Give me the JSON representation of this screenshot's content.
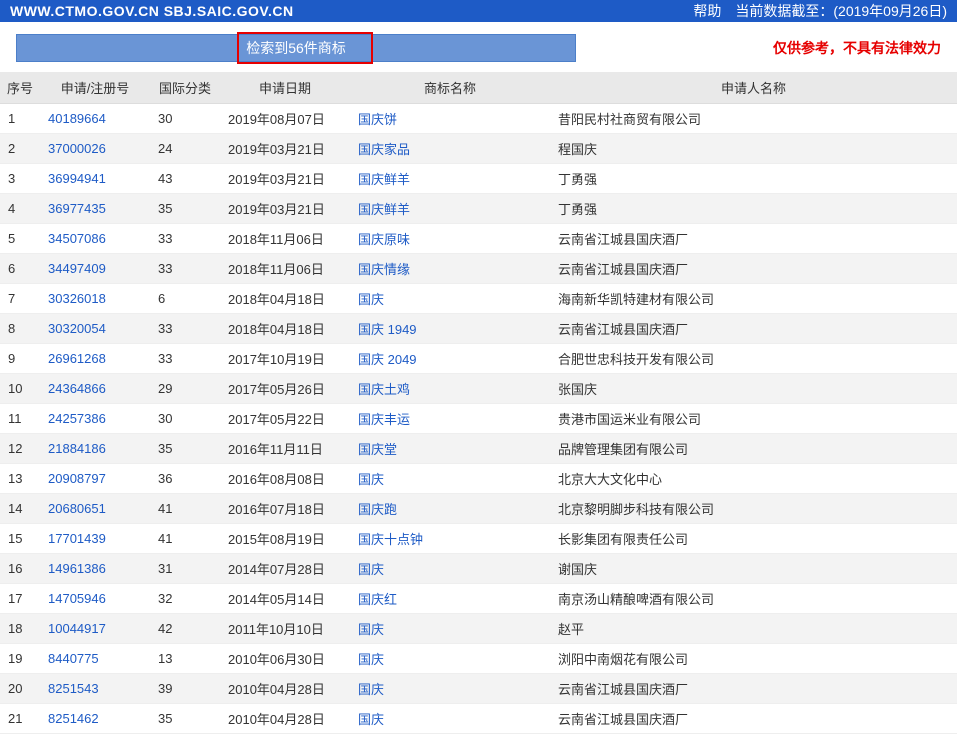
{
  "header": {
    "urls": "WWW.CTMO.GOV.CN SBJ.SAIC.GOV.CN",
    "help": "帮助",
    "data_date_label": "当前数据截至：(2019年09月26日)"
  },
  "result_banner": "检索到56件商标",
  "disclaimer": "仅供参考，不具有法律效力",
  "columns": {
    "seq": "序号",
    "reg": "申请/注册号",
    "cls": "国际分类",
    "date": "申请日期",
    "name": "商标名称",
    "applicant": "申请人名称"
  },
  "rows": [
    {
      "seq": "1",
      "reg": "40189664",
      "cls": "30",
      "date": "2019年08月07日",
      "name": "国庆饼",
      "applicant": "昔阳民村社商贸有限公司"
    },
    {
      "seq": "2",
      "reg": "37000026",
      "cls": "24",
      "date": "2019年03月21日",
      "name": "国庆家品",
      "applicant": "程国庆"
    },
    {
      "seq": "3",
      "reg": "36994941",
      "cls": "43",
      "date": "2019年03月21日",
      "name": "国庆鲜羊",
      "applicant": "丁勇强"
    },
    {
      "seq": "4",
      "reg": "36977435",
      "cls": "35",
      "date": "2019年03月21日",
      "name": "国庆鲜羊",
      "applicant": "丁勇强"
    },
    {
      "seq": "5",
      "reg": "34507086",
      "cls": "33",
      "date": "2018年11月06日",
      "name": "国庆原味",
      "applicant": "云南省江城县国庆酒厂"
    },
    {
      "seq": "6",
      "reg": "34497409",
      "cls": "33",
      "date": "2018年11月06日",
      "name": "国庆情缘",
      "applicant": "云南省江城县国庆酒厂"
    },
    {
      "seq": "7",
      "reg": "30326018",
      "cls": "6",
      "date": "2018年04月18日",
      "name": "国庆",
      "applicant": "海南新华凯特建材有限公司"
    },
    {
      "seq": "8",
      "reg": "30320054",
      "cls": "33",
      "date": "2018年04月18日",
      "name": "国庆 1949",
      "applicant": "云南省江城县国庆酒厂"
    },
    {
      "seq": "9",
      "reg": "26961268",
      "cls": "33",
      "date": "2017年10月19日",
      "name": "国庆 2049",
      "applicant": "合肥世忠科技开发有限公司"
    },
    {
      "seq": "10",
      "reg": "24364866",
      "cls": "29",
      "date": "2017年05月26日",
      "name": "国庆土鸡",
      "applicant": "张国庆"
    },
    {
      "seq": "11",
      "reg": "24257386",
      "cls": "30",
      "date": "2017年05月22日",
      "name": "国庆丰运",
      "applicant": "贵港市国运米业有限公司"
    },
    {
      "seq": "12",
      "reg": "21884186",
      "cls": "35",
      "date": "2016年11月11日",
      "name": "国庆堂",
      "applicant": "品牌管理集团有限公司"
    },
    {
      "seq": "13",
      "reg": "20908797",
      "cls": "36",
      "date": "2016年08月08日",
      "name": "国庆",
      "applicant": "北京大大文化中心"
    },
    {
      "seq": "14",
      "reg": "20680651",
      "cls": "41",
      "date": "2016年07月18日",
      "name": "国庆跑",
      "applicant": "北京黎明脚步科技有限公司"
    },
    {
      "seq": "15",
      "reg": "17701439",
      "cls": "41",
      "date": "2015年08月19日",
      "name": "国庆十点钟",
      "applicant": "长影集团有限责任公司"
    },
    {
      "seq": "16",
      "reg": "14961386",
      "cls": "31",
      "date": "2014年07月28日",
      "name": "国庆",
      "applicant": "谢国庆"
    },
    {
      "seq": "17",
      "reg": "14705946",
      "cls": "32",
      "date": "2014年05月14日",
      "name": "国庆红",
      "applicant": "南京汤山精酿啤酒有限公司"
    },
    {
      "seq": "18",
      "reg": "10044917",
      "cls": "42",
      "date": "2011年10月10日",
      "name": "国庆",
      "applicant": "赵平"
    },
    {
      "seq": "19",
      "reg": "8440775",
      "cls": "13",
      "date": "2010年06月30日",
      "name": "国庆",
      "applicant": "浏阳中南烟花有限公司"
    },
    {
      "seq": "20",
      "reg": "8251543",
      "cls": "39",
      "date": "2010年04月28日",
      "name": "国庆",
      "applicant": "云南省江城县国庆酒厂"
    },
    {
      "seq": "21",
      "reg": "8251462",
      "cls": "35",
      "date": "2010年04月28日",
      "name": "国庆",
      "applicant": "云南省江城县国庆酒厂"
    }
  ]
}
